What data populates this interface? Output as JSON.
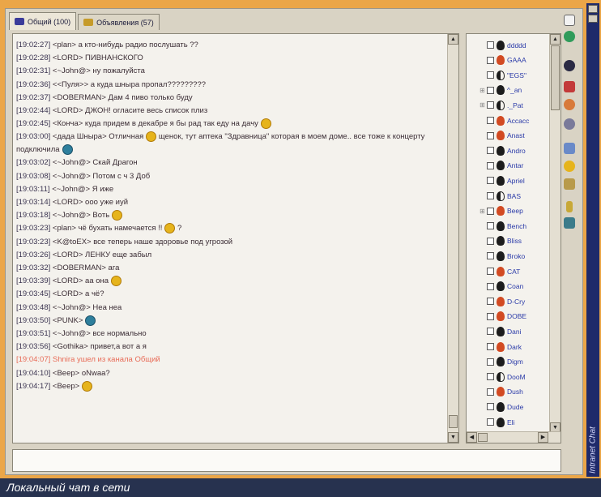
{
  "tabs": [
    {
      "label": "Общий (100)",
      "active": true
    },
    {
      "label": "Объявления (57)",
      "active": false
    }
  ],
  "chat": {
    "lines": [
      {
        "ts": "[19:02:27]",
        "text": " <plan> а кто-нибудь радио послушать ??"
      },
      {
        "ts": "[19:02:28]",
        "text": " <LORD> ПИВНАНСКОГО"
      },
      {
        "ts": "[19:02:31]",
        "text": " <~John@> ну пожалуйста"
      },
      {
        "ts": "[19:02:36]",
        "text": " <<Пуля>> а куда шныра пропал?????????"
      },
      {
        "ts": "[19:02:37]",
        "text": " <DOBERMAN> Дам 4 пиво только буду"
      },
      {
        "ts": "[19:02:44]",
        "text": " <LORD> ДЖОН! огласите весь список плиз"
      },
      {
        "ts": "[19:02:45]",
        "text": " <Конча> куда придем в декабре я бы рад так еду на дачу",
        "smile": "yellow"
      },
      {
        "ts": "[19:03:00]",
        "text": " <дада Шныра> Отличная",
        "smile": "yellow",
        "after": " щенок, тут аптека \"Здравница\" которая в моем доме.. все тоже к концерту подключила",
        "wrap": true,
        "smile2": "blue"
      },
      {
        "ts": "[19:03:02]",
        "text": " <~John@> Скай Драгон"
      },
      {
        "ts": "[19:03:08]",
        "text": " <~John@> Потом  с ч 3  Доб"
      },
      {
        "ts": "[19:03:11]",
        "text": " <~John@> Я  иже"
      },
      {
        "ts": "[19:03:14]",
        "text": " <LORD> ооо  уже иуй"
      },
      {
        "ts": "[19:03:18]",
        "text": " <~John@> Воть",
        "smile": "yellow"
      },
      {
        "ts": "[19:03:23]",
        "text": " <plan> чё бухать намечается !!",
        "smile": "yellow",
        "after": " ?"
      },
      {
        "ts": "[19:03:23]",
        "text": " <K@toEX> все теперь наше здоровье под угрозой"
      },
      {
        "ts": "[19:03:26]",
        "text": " <LORD> ЛЕНКУ еще забыл"
      },
      {
        "ts": "[19:03:32]",
        "text": " <DOBERMAN> ага"
      },
      {
        "ts": "[19:03:39]",
        "text": " <LORD> аа она",
        "smile": "yellow"
      },
      {
        "ts": "[19:03:45]",
        "text": " <LORD> а чё?"
      },
      {
        "ts": "[19:03:48]",
        "text": " <~John@> Неа неа"
      },
      {
        "ts": "[19:03:50]",
        "text": " <PUNK>",
        "smile": "blue"
      },
      {
        "ts": "[19:03:51]",
        "text": " <~John@> все  нормально"
      },
      {
        "ts": "[19:03:56]",
        "text": " <Gothika> привет,а  вот  а  я"
      },
      {
        "ts": "",
        "text": "[19:04:07] Shnira ушел из канала Общий",
        "red": true
      },
      {
        "ts": "[19:04:10]",
        "text": " <Beep> oNwaa?"
      },
      {
        "ts": "[19:04:17]",
        "text": " <Beep>",
        "smile": "yellow"
      }
    ]
  },
  "users": [
    {
      "name": "ddddd",
      "icon": "black",
      "plus": false
    },
    {
      "name": "GAAA",
      "icon": "red",
      "plus": false
    },
    {
      "name": "\"EGS\"",
      "icon": "bw",
      "plus": false
    },
    {
      "name": "^_an",
      "icon": "black",
      "plus": true
    },
    {
      "name": "._Pat",
      "icon": "bw",
      "plus": true
    },
    {
      "name": "Ассасс",
      "icon": "red",
      "plus": false
    },
    {
      "name": "Anast",
      "icon": "red",
      "plus": false
    },
    {
      "name": "Andro",
      "icon": "black",
      "plus": false
    },
    {
      "name": "Antar",
      "icon": "black",
      "plus": false
    },
    {
      "name": "Apriel",
      "icon": "black",
      "plus": false
    },
    {
      "name": "BAS",
      "icon": "bw",
      "plus": false
    },
    {
      "name": "Beep",
      "icon": "red",
      "plus": true
    },
    {
      "name": "Bench",
      "icon": "black",
      "plus": false
    },
    {
      "name": "Bliss",
      "icon": "black",
      "plus": false
    },
    {
      "name": "Broko",
      "icon": "black",
      "plus": false
    },
    {
      "name": "CAT",
      "icon": "red",
      "plus": false
    },
    {
      "name": "Coan",
      "icon": "black",
      "plus": false
    },
    {
      "name": "D-Cry",
      "icon": "red",
      "plus": false
    },
    {
      "name": "DOBE",
      "icon": "red",
      "plus": false
    },
    {
      "name": "Dani",
      "icon": "black",
      "plus": false
    },
    {
      "name": "Dark",
      "icon": "red",
      "plus": false
    },
    {
      "name": "Digm",
      "icon": "black",
      "plus": false
    },
    {
      "name": "DooM",
      "icon": "bw",
      "plus": false
    },
    {
      "name": "Dush",
      "icon": "red",
      "plus": false
    },
    {
      "name": "Dude",
      "icon": "black",
      "plus": false
    },
    {
      "name": "Eli",
      "icon": "black",
      "plus": false
    }
  ],
  "sidebar_label": "Intranet Chat",
  "caption": "Локальный чат в сети",
  "toolbar_icons": [
    "document-icon",
    "refresh-icon",
    "user-icon",
    "user-red-icon",
    "user-orange-icon",
    "link-icon",
    "window-icon",
    "smile-icon",
    "folder-icon",
    "key-icon",
    "users-icon"
  ],
  "colors": {
    "frame": "#eba648",
    "caption_bg": "#27324f",
    "vbar": "#1f2a6a",
    "username": "#2a3aa8",
    "system_msg": "#e86c58"
  }
}
